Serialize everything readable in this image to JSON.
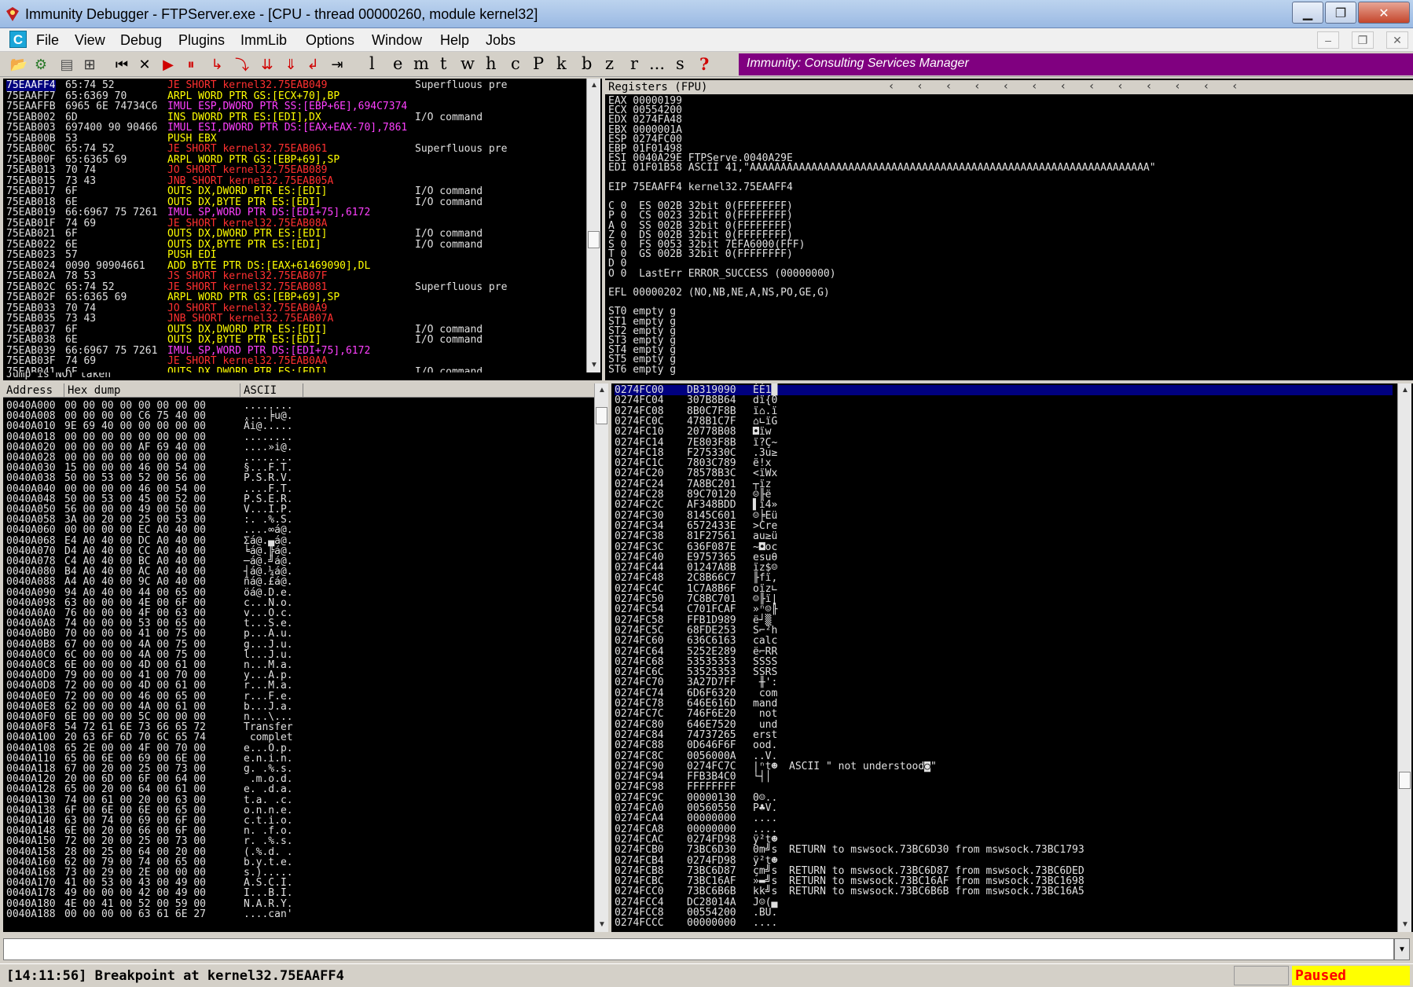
{
  "window": {
    "title": "Immunity Debugger - FTPServer.exe - [CPU - thread 00000260, module kernel32]",
    "minimize": "▁",
    "maximize": "❐",
    "close": "✕"
  },
  "menu": {
    "icon_letter": "C",
    "items": [
      "File",
      "View",
      "Debug",
      "Plugins",
      "ImmLib",
      "Options",
      "Window",
      "Help",
      "Jobs"
    ],
    "mdi": [
      "–",
      "❐",
      "✕"
    ]
  },
  "toolbar": {
    "letters": [
      "l",
      "e",
      "m",
      "t",
      "w",
      "h",
      "c",
      "P",
      "k",
      "b",
      "z",
      "r",
      "...",
      "s",
      "?"
    ],
    "banner": "Immunity: Consulting Services Manager"
  },
  "disasm": {
    "rows": [
      {
        "addr": "75EAAFF4",
        "hex": "65:74 52",
        "instr": "JE SHORT kernel32.75EAB049",
        "comment": "Superfluous pre",
        "color": "red",
        "selected": true
      },
      {
        "addr": "75EAAFF7",
        "hex": "65:6369 70",
        "instr": "ARPL WORD PTR GS:[ECX+70],BP",
        "comment": "",
        "color": "yellow"
      },
      {
        "addr": "75EAAFFB",
        "hex": "6965 6E 74734C6",
        "instr": "IMUL ESP,DWORD PTR SS:[EBP+6E],694C7374",
        "comment": "",
        "color": "mixed"
      },
      {
        "addr": "75EAB002",
        "hex": "6D",
        "instr": "INS DWORD PTR ES:[EDI],DX",
        "comment": "I/O command",
        "color": "yellow"
      },
      {
        "addr": "75EAB003",
        "hex": "697400 90 90466",
        "instr": "IMUL ESI,DWORD PTR DS:[EAX+EAX-70],7861",
        "comment": "",
        "color": "mixed"
      },
      {
        "addr": "75EAB00B",
        "hex": "53",
        "instr": "PUSH EBX",
        "comment": "",
        "color": "yellow"
      },
      {
        "addr": "75EAB00C",
        "hex": "65:74 52",
        "instr": "JE SHORT kernel32.75EAB061",
        "comment": "Superfluous pre",
        "color": "red"
      },
      {
        "addr": "75EAB00F",
        "hex": "65:6365 69",
        "instr": "ARPL WORD PTR GS:[EBP+69],SP",
        "comment": "",
        "color": "yellow"
      },
      {
        "addr": "75EAB013",
        "hex": "70 74",
        "instr": "JO SHORT kernel32.75EAB089",
        "comment": "",
        "color": "red"
      },
      {
        "addr": "75EAB015",
        "hex": "73 43",
        "instr": "JNB SHORT kernel32.75EAB05A",
        "comment": "",
        "color": "red"
      },
      {
        "addr": "75EAB017",
        "hex": "6F",
        "instr": "OUTS DX,DWORD PTR ES:[EDI]",
        "comment": "I/O command",
        "color": "yellow"
      },
      {
        "addr": "75EAB018",
        "hex": "6E",
        "instr": "OUTS DX,BYTE PTR ES:[EDI]",
        "comment": "I/O command",
        "color": "yellow"
      },
      {
        "addr": "75EAB019",
        "hex": "66:6967 75 7261",
        "instr": "IMUL SP,WORD PTR DS:[EDI+75],6172",
        "comment": "",
        "color": "mixed"
      },
      {
        "addr": "75EAB01F",
        "hex": "74 69",
        "instr": "JE SHORT kernel32.75EAB08A",
        "comment": "",
        "color": "red"
      },
      {
        "addr": "75EAB021",
        "hex": "6F",
        "instr": "OUTS DX,DWORD PTR ES:[EDI]",
        "comment": "I/O command",
        "color": "yellow"
      },
      {
        "addr": "75EAB022",
        "hex": "6E",
        "instr": "OUTS DX,BYTE PTR ES:[EDI]",
        "comment": "I/O command",
        "color": "yellow"
      },
      {
        "addr": "75EAB023",
        "hex": "57",
        "instr": "PUSH EDI",
        "comment": "",
        "color": "yellow"
      },
      {
        "addr": "75EAB024",
        "hex": "0090 90904661",
        "instr": "ADD BYTE PTR DS:[EAX+61469090],DL",
        "comment": "",
        "color": "yellow"
      },
      {
        "addr": "75EAB02A",
        "hex": "78 53",
        "instr": "JS SHORT kernel32.75EAB07F",
        "comment": "",
        "color": "red"
      },
      {
        "addr": "75EAB02C",
        "hex": "65:74 52",
        "instr": "JE SHORT kernel32.75EAB081",
        "comment": "Superfluous pre",
        "color": "red"
      },
      {
        "addr": "75EAB02F",
        "hex": "65:6365 69",
        "instr": "ARPL WORD PTR GS:[EBP+69],SP",
        "comment": "",
        "color": "yellow"
      },
      {
        "addr": "75EAB033",
        "hex": "70 74",
        "instr": "JO SHORT kernel32.75EAB0A9",
        "comment": "",
        "color": "red"
      },
      {
        "addr": "75EAB035",
        "hex": "73 43",
        "instr": "JNB SHORT kernel32.75EAB07A",
        "comment": "",
        "color": "red"
      },
      {
        "addr": "75EAB037",
        "hex": "6F",
        "instr": "OUTS DX,DWORD PTR ES:[EDI]",
        "comment": "I/O command",
        "color": "yellow"
      },
      {
        "addr": "75EAB038",
        "hex": "6E",
        "instr": "OUTS DX,BYTE PTR ES:[EDI]",
        "comment": "I/O command",
        "color": "yellow"
      },
      {
        "addr": "75EAB039",
        "hex": "66:6967 75 7261",
        "instr": "IMUL SP,WORD PTR DS:[EDI+75],6172",
        "comment": "",
        "color": "mixed"
      },
      {
        "addr": "75EAB03F",
        "hex": "74 69",
        "instr": "JE SHORT kernel32.75EAB0AA",
        "comment": "",
        "color": "red"
      },
      {
        "addr": "75EAB041",
        "hex": "6F",
        "instr": "OUTS DX,DWORD PTR ES:[EDI]",
        "comment": "I/O command",
        "color": "yellow"
      }
    ],
    "info": "Jump is NOT taken"
  },
  "registers": {
    "header": "Registers (FPU)",
    "lines": [
      "EAX 00000199",
      "ECX 00554200",
      "EDX 0274FA48",
      "EBX 0000001A",
      "ESP 0274FC00",
      "EBP 01F01498",
      "ESI 0040A29E FTPServe.0040A29E",
      "EDI 01F01B58 ASCII 41,\"AAAAAAAAAAAAAAAAAAAAAAAAAAAAAAAAAAAAAAAAAAAAAAAAAAAAAAAAAAAAAAAAA\"",
      "",
      "EIP 75EAAFF4 kernel32.75EAAFF4",
      "",
      "C 0  ES 002B 32bit 0(FFFFFFFF)",
      "P 0  CS 0023 32bit 0(FFFFFFFF)",
      "A 0  SS 002B 32bit 0(FFFFFFFF)",
      "Z 0  DS 002B 32bit 0(FFFFFFFF)",
      "S 0  FS 0053 32bit 7EFA6000(FFF)",
      "T 0  GS 002B 32bit 0(FFFFFFFF)",
      "D 0",
      "O 0  LastErr ERROR_SUCCESS (00000000)",
      "",
      "EFL 00000202 (NO,NB,NE,A,NS,PO,GE,G)",
      "",
      "ST0 empty g",
      "ST1 empty g",
      "ST2 empty g",
      "ST3 empty g",
      "ST4 empty g",
      "ST5 empty g",
      "ST6 empty g"
    ]
  },
  "dump": {
    "headers": [
      "Address",
      "Hex dump",
      "ASCII"
    ],
    "rows": [
      [
        "0040A000",
        "00 00 00 00 00 00 00 00",
        "........"
      ],
      [
        "0040A008",
        "00 00 00 00 C6 75 40 00",
        "....╞u@."
      ],
      [
        "0040A010",
        "9E 69 40 00 00 00 00 00",
        "Äi@....."
      ],
      [
        "0040A018",
        "00 00 00 00 00 00 00 00",
        "........"
      ],
      [
        "0040A020",
        "00 00 00 00 AF 69 40 00",
        "....»i@."
      ],
      [
        "0040A028",
        "00 00 00 00 00 00 00 00",
        "........"
      ],
      [
        "0040A030",
        "15 00 00 00 46 00 54 00",
        "§...F.T."
      ],
      [
        "0040A038",
        "50 00 53 00 52 00 56 00",
        "P.S.R.V."
      ],
      [
        "0040A040",
        "00 00 00 00 46 00 54 00",
        "....F.T."
      ],
      [
        "0040A048",
        "50 00 53 00 45 00 52 00",
        "P.S.E.R."
      ],
      [
        "0040A050",
        "56 00 00 00 49 00 50 00",
        "V...I.P."
      ],
      [
        "0040A058",
        "3A 00 20 00 25 00 53 00",
        ":. .%.S."
      ],
      [
        "0040A060",
        "00 00 00 00 EC A0 40 00",
        "....∞á@."
      ],
      [
        "0040A068",
        "E4 A0 40 00 DC A0 40 00",
        "Σá@.▄á@."
      ],
      [
        "0040A070",
        "D4 A0 40 00 CC A0 40 00",
        "╘á@.╠á@."
      ],
      [
        "0040A078",
        "C4 A0 40 00 BC A0 40 00",
        "─á@.╝á@."
      ],
      [
        "0040A080",
        "B4 A0 40 00 AC A0 40 00",
        "┤á@.¼á@."
      ],
      [
        "0040A088",
        "A4 A0 40 00 9C A0 40 00",
        "ñá@.£á@."
      ],
      [
        "0040A090",
        "94 A0 40 00 44 00 65 00",
        "öá@.D.e."
      ],
      [
        "0040A098",
        "63 00 00 00 4E 00 6F 00",
        "c...N.o."
      ],
      [
        "0040A0A0",
        "76 00 00 00 4F 00 63 00",
        "v...O.c."
      ],
      [
        "0040A0A8",
        "74 00 00 00 53 00 65 00",
        "t...S.e."
      ],
      [
        "0040A0B0",
        "70 00 00 00 41 00 75 00",
        "p...A.u."
      ],
      [
        "0040A0B8",
        "67 00 00 00 4A 00 75 00",
        "g...J.u."
      ],
      [
        "0040A0C0",
        "6C 00 00 00 4A 00 75 00",
        "l...J.u."
      ],
      [
        "0040A0C8",
        "6E 00 00 00 4D 00 61 00",
        "n...M.a."
      ],
      [
        "0040A0D0",
        "79 00 00 00 41 00 70 00",
        "y...A.p."
      ],
      [
        "0040A0D8",
        "72 00 00 00 4D 00 61 00",
        "r...M.a."
      ],
      [
        "0040A0E0",
        "72 00 00 00 46 00 65 00",
        "r...F.e."
      ],
      [
        "0040A0E8",
        "62 00 00 00 4A 00 61 00",
        "b...J.a."
      ],
      [
        "0040A0F0",
        "6E 00 00 00 5C 00 00 00",
        "n...\\..."
      ],
      [
        "0040A0F8",
        "54 72 61 6E 73 66 65 72",
        "Transfer"
      ],
      [
        "0040A100",
        "20 63 6F 6D 70 6C 65 74",
        " complet"
      ],
      [
        "0040A108",
        "65 2E 00 00 4F 00 70 00",
        "e...O.p."
      ],
      [
        "0040A110",
        "65 00 6E 00 69 00 6E 00",
        "e.n.i.n."
      ],
      [
        "0040A118",
        "67 00 20 00 25 00 73 00",
        "g. .%.s."
      ],
      [
        "0040A120",
        "20 00 6D 00 6F 00 64 00",
        " .m.o.d."
      ],
      [
        "0040A128",
        "65 00 20 00 64 00 61 00",
        "e. .d.a."
      ],
      [
        "0040A130",
        "74 00 61 00 20 00 63 00",
        "t.a. .c."
      ],
      [
        "0040A138",
        "6F 00 6E 00 6E 00 65 00",
        "o.n.n.e."
      ],
      [
        "0040A140",
        "63 00 74 00 69 00 6F 00",
        "c.t.i.o."
      ],
      [
        "0040A148",
        "6E 00 20 00 66 00 6F 00",
        "n. .f.o."
      ],
      [
        "0040A150",
        "72 00 20 00 25 00 73 00",
        "r. .%.s."
      ],
      [
        "0040A158",
        "28 00 25 00 64 00 20 00",
        "(.%.d. ."
      ],
      [
        "0040A160",
        "62 00 79 00 74 00 65 00",
        "b.y.t.e."
      ],
      [
        "0040A168",
        "73 00 29 00 2E 00 00 00",
        "s.)....."
      ],
      [
        "0040A170",
        "41 00 53 00 43 00 49 00",
        "A.S.C.I."
      ],
      [
        "0040A178",
        "49 00 00 00 42 00 49 00",
        "I...B.I."
      ],
      [
        "0040A180",
        "4E 00 41 00 52 00 59 00",
        "N.A.R.Y."
      ],
      [
        "0040A188",
        "00 00 00 00 63 61 6E 27",
        "....can'"
      ]
    ]
  },
  "stack": {
    "rows": [
      [
        "0274FC00",
        "DB319090",
        "ÉÉ1█",
        ""
      ],
      [
        "0274FC04",
        "307B8B64",
        "dï{0",
        ""
      ],
      [
        "0274FC08",
        "8B0C7F8B",
        "ï⌂.ï",
        ""
      ],
      [
        "0274FC0C",
        "478B1C7F",
        "⌂∟ïG",
        ""
      ],
      [
        "0274FC10",
        "20778B08",
        "◘ïw ",
        ""
      ],
      [
        "0274FC14",
        "7E803F8B",
        "ï?Ç~",
        ""
      ],
      [
        "0274FC18",
        "F275330C",
        ".3u≥",
        ""
      ],
      [
        "0274FC1C",
        "7803C789",
        "ëǃx",
        ""
      ],
      [
        "0274FC20",
        "78578B3C",
        "<ïWx",
        ""
      ],
      [
        "0274FC24",
        "7A8BC201",
        "┬ïz",
        ""
      ],
      [
        "0274FC28",
        "89C70120",
        "☺╟ë",
        ""
      ],
      [
        "0274FC2C",
        "AF348BDD",
        "▌ï4»",
        ""
      ],
      [
        "0274FC30",
        "8145C601",
        "☺╞Eü",
        ""
      ],
      [
        "0274FC34",
        "6572433E",
        ">Cre",
        ""
      ],
      [
        "0274FC38",
        "81F27561",
        "au≥ü",
        ""
      ],
      [
        "0274FC3C",
        "636F087E",
        "~◘oc",
        ""
      ],
      [
        "0274FC40",
        "E9757365",
        "esuθ",
        ""
      ],
      [
        "0274FC44",
        "01247A8B",
        "ïz$☺",
        ""
      ],
      [
        "0274FC48",
        "2C8B66C7",
        "╟fï,",
        ""
      ],
      [
        "0274FC4C",
        "1C7A8B6F",
        "oïz∟",
        ""
      ],
      [
        "0274FC50",
        "7C8BC701",
        "☺╟ï|",
        ""
      ],
      [
        "0274FC54",
        "C701FCAF",
        "»ⁿ☺╟",
        ""
      ],
      [
        "0274FC58",
        "FFB1D989",
        "ë┘▒ ",
        ""
      ],
      [
        "0274FC5C",
        "68FDE253",
        "S⌐²h",
        ""
      ],
      [
        "0274FC60",
        "636C6163",
        "calc",
        ""
      ],
      [
        "0274FC64",
        "5252E289",
        "ë⌐RR",
        ""
      ],
      [
        "0274FC68",
        "53535353",
        "SSSS",
        ""
      ],
      [
        "0274FC6C",
        "53525353",
        "SSRS",
        ""
      ],
      [
        "0274FC70",
        "3A27D7FF",
        " ╫':",
        ""
      ],
      [
        "0274FC74",
        "6D6F6320",
        " com",
        ""
      ],
      [
        "0274FC78",
        "646E616D",
        "mand",
        ""
      ],
      [
        "0274FC7C",
        "746F6E20",
        " not",
        ""
      ],
      [
        "0274FC80",
        "646E7520",
        " und",
        ""
      ],
      [
        "0274FC84",
        "74737265",
        "erst",
        ""
      ],
      [
        "0274FC88",
        "0D646F6F",
        "ood.",
        ""
      ],
      [
        "0274FC8C",
        "0056000A",
        "..V.",
        ""
      ],
      [
        "0274FC90",
        "0274FC7C",
        "|ⁿt☻",
        "ASCII \" not understood◙\""
      ],
      [
        "0274FC94",
        "FFB3B4C0",
        "└┤│ ",
        ""
      ],
      [
        "0274FC98",
        "FFFFFFFF",
        "    ",
        ""
      ],
      [
        "0274FC9C",
        "00000130",
        "0☺..",
        ""
      ],
      [
        "0274FCA0",
        "00560550",
        "P♣V.",
        ""
      ],
      [
        "0274FCA4",
        "00000000",
        "....",
        ""
      ],
      [
        "0274FCA8",
        "00000000",
        "....",
        ""
      ],
      [
        "0274FCAC",
        "0274FD98",
        "ÿ²t☻",
        ""
      ],
      [
        "0274FCB0",
        "73BC6D30",
        "0m╝s",
        "RETURN to mswsock.73BC6D30 from mswsock.73BC1793"
      ],
      [
        "0274FCB4",
        "0274FD98",
        "ÿ²t☻",
        ""
      ],
      [
        "0274FCB8",
        "73BC6D87",
        "çm╝s",
        "RETURN to mswsock.73BC6D87 from mswsock.73BC6DED"
      ],
      [
        "0274FCBC",
        "73BC16AF",
        "»▬╝s",
        "RETURN to mswsock.73BC16AF from mswsock.73BC1698"
      ],
      [
        "0274FCC0",
        "73BC6B6B",
        "kk╝s",
        "RETURN to mswsock.73BC6B6B from mswsock.73BC16A5"
      ],
      [
        "0274FCC4",
        "DC28014A",
        "J☺(▄",
        ""
      ],
      [
        "0274FCC8",
        "00554200",
        ".BU.",
        ""
      ],
      [
        "0274FCCC",
        "00000000",
        "....",
        ""
      ]
    ]
  },
  "status": {
    "message": "[14:11:56] Breakpoint at kernel32.75EAAFF4",
    "state": "Paused"
  }
}
